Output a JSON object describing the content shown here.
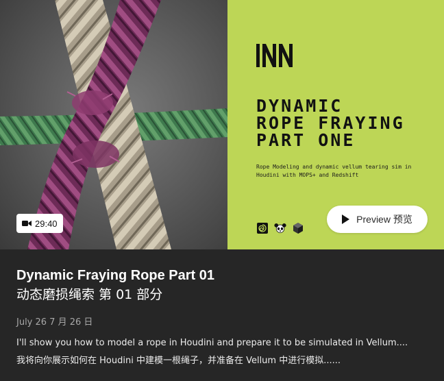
{
  "thumbnail": {
    "headline": "DYNAMIC\nROPE FRAYING\nPART ONE",
    "subtitle": "Rope Modeling and dynamic vellum tearing sim in Houdini with MOPS+ and Redshift",
    "tools": [
      "houdini-icon",
      "mops-icon",
      "redshift-icon"
    ],
    "preview_label": "Preview 预览",
    "duration": "29:40",
    "accent_color": "#bdd656"
  },
  "video": {
    "title_en": "Dynamic Fraying Rope Part 01",
    "title_zh": "动态磨损绳索 第 01 部分",
    "date": "July 26 7 月 26 日",
    "description_en": "I'll show you how to model a rope in Houdini and prepare it to be simulated in Vellum....",
    "description_zh": "我将向你展示如何在 Houdini 中建模一根绳子，并准备在 Vellum 中进行模拟......"
  }
}
